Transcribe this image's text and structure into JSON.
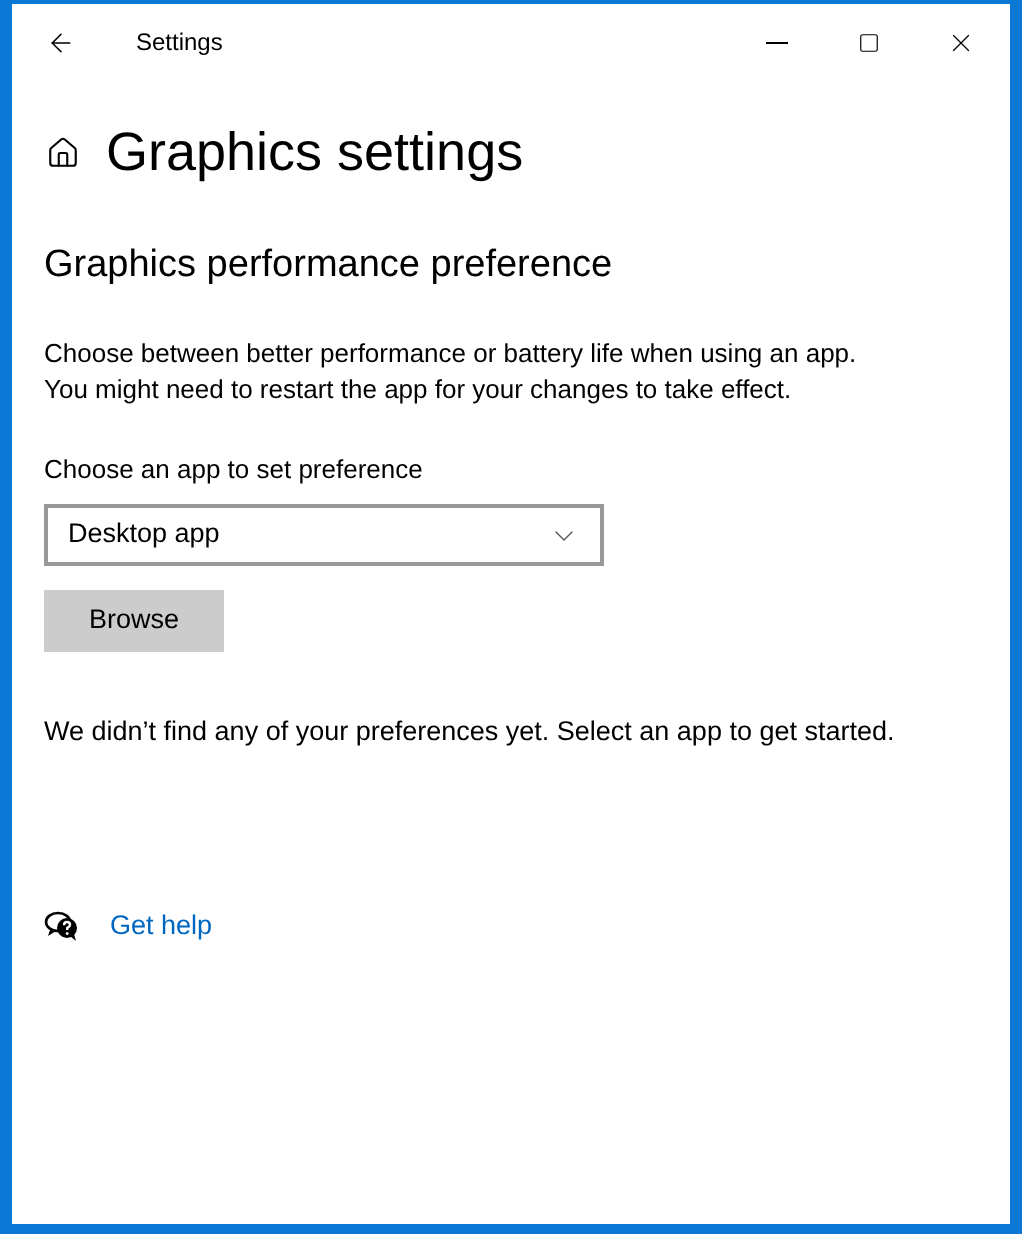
{
  "window": {
    "title": "Settings"
  },
  "page": {
    "title": "Graphics settings"
  },
  "section": {
    "title": "Graphics performance preference",
    "description": [
      "Choose between better performance or battery life when using an app.",
      "You might need to restart the app for your changes to take effect."
    ]
  },
  "app_picker": {
    "label": "Choose an app to set preference",
    "value": "Desktop app",
    "button": "Browse"
  },
  "empty_message": "We didn’t find any of your preferences yet. Select an app to get started.",
  "help_link": "Get help"
}
